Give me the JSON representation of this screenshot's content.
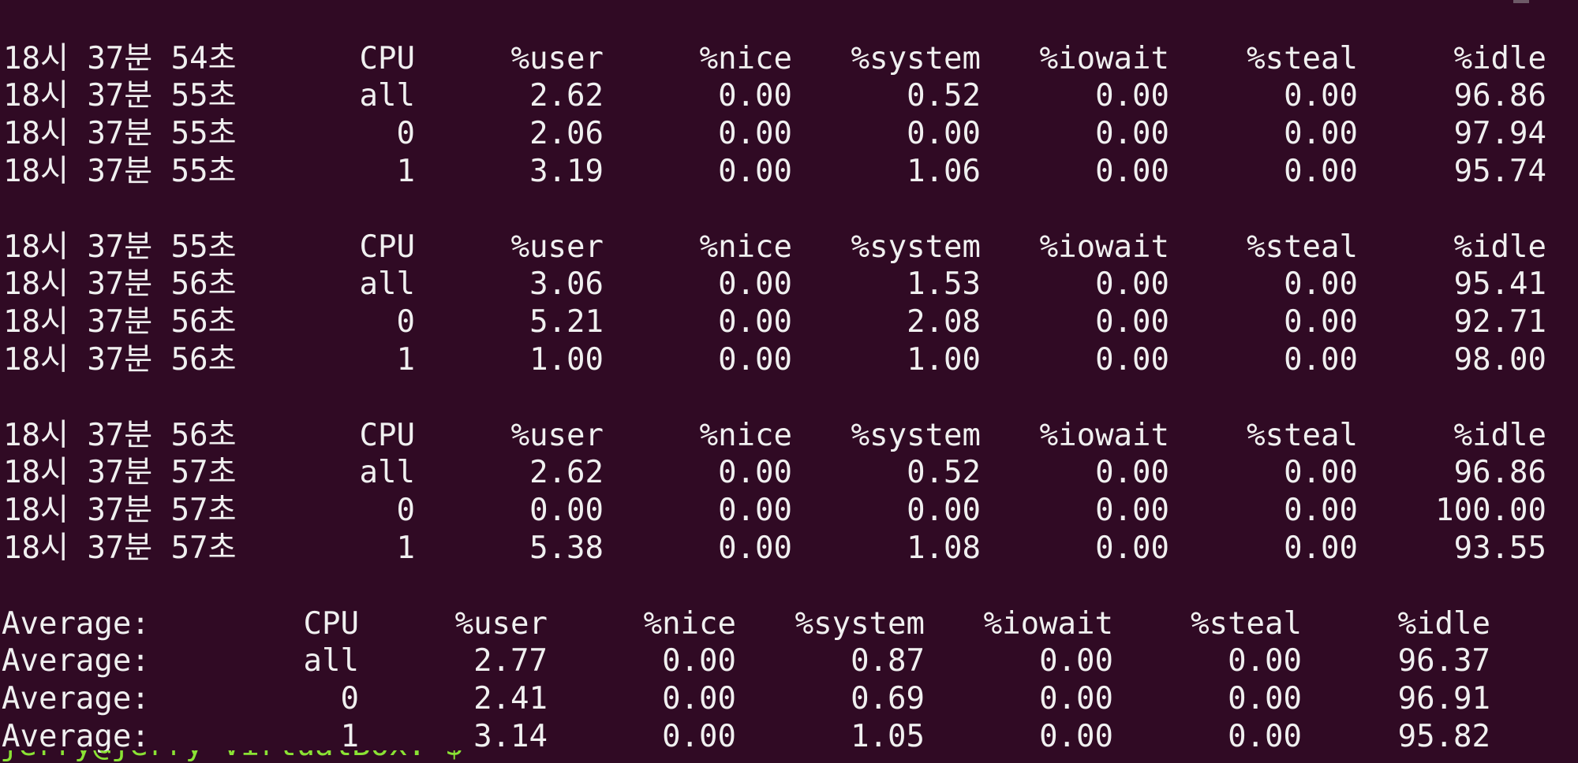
{
  "header": [
    "CPU",
    "%user",
    "%nice",
    "%system",
    "%iowait",
    "%steal",
    "%idle"
  ],
  "blocks": [
    {
      "header_time": "18시 37분 54초",
      "rows": [
        {
          "time": "18시 37분 55초",
          "cpu": "all",
          "user": "2.62",
          "nice": "0.00",
          "system": "0.52",
          "iowait": "0.00",
          "steal": "0.00",
          "idle": "96.86"
        },
        {
          "time": "18시 37분 55초",
          "cpu": "0",
          "user": "2.06",
          "nice": "0.00",
          "system": "0.00",
          "iowait": "0.00",
          "steal": "0.00",
          "idle": "97.94"
        },
        {
          "time": "18시 37분 55초",
          "cpu": "1",
          "user": "3.19",
          "nice": "0.00",
          "system": "1.06",
          "iowait": "0.00",
          "steal": "0.00",
          "idle": "95.74"
        }
      ]
    },
    {
      "header_time": "18시 37분 55초",
      "rows": [
        {
          "time": "18시 37분 56초",
          "cpu": "all",
          "user": "3.06",
          "nice": "0.00",
          "system": "1.53",
          "iowait": "0.00",
          "steal": "0.00",
          "idle": "95.41"
        },
        {
          "time": "18시 37분 56초",
          "cpu": "0",
          "user": "5.21",
          "nice": "0.00",
          "system": "2.08",
          "iowait": "0.00",
          "steal": "0.00",
          "idle": "92.71"
        },
        {
          "time": "18시 37분 56초",
          "cpu": "1",
          "user": "1.00",
          "nice": "0.00",
          "system": "1.00",
          "iowait": "0.00",
          "steal": "0.00",
          "idle": "98.00"
        }
      ]
    },
    {
      "header_time": "18시 37분 56초",
      "rows": [
        {
          "time": "18시 37분 57초",
          "cpu": "all",
          "user": "2.62",
          "nice": "0.00",
          "system": "0.52",
          "iowait": "0.00",
          "steal": "0.00",
          "idle": "96.86"
        },
        {
          "time": "18시 37분 57초",
          "cpu": "0",
          "user": "0.00",
          "nice": "0.00",
          "system": "0.00",
          "iowait": "0.00",
          "steal": "0.00",
          "idle": "100.00"
        },
        {
          "time": "18시 37분 57초",
          "cpu": "1",
          "user": "5.38",
          "nice": "0.00",
          "system": "1.08",
          "iowait": "0.00",
          "steal": "0.00",
          "idle": "93.55"
        }
      ]
    }
  ],
  "average": {
    "label": "Average:",
    "rows": [
      {
        "cpu": "all",
        "user": "2.77",
        "nice": "0.00",
        "system": "0.87",
        "iowait": "0.00",
        "steal": "0.00",
        "idle": "96.37"
      },
      {
        "cpu": "0",
        "user": "2.41",
        "nice": "0.00",
        "system": "0.69",
        "iowait": "0.00",
        "steal": "0.00",
        "idle": "96.91"
      },
      {
        "cpu": "1",
        "user": "3.14",
        "nice": "0.00",
        "system": "1.05",
        "iowait": "0.00",
        "steal": "0.00",
        "idle": "95.82"
      }
    ]
  },
  "prompt_fragment": "jerry@jerry-VirtualBox:~$"
}
